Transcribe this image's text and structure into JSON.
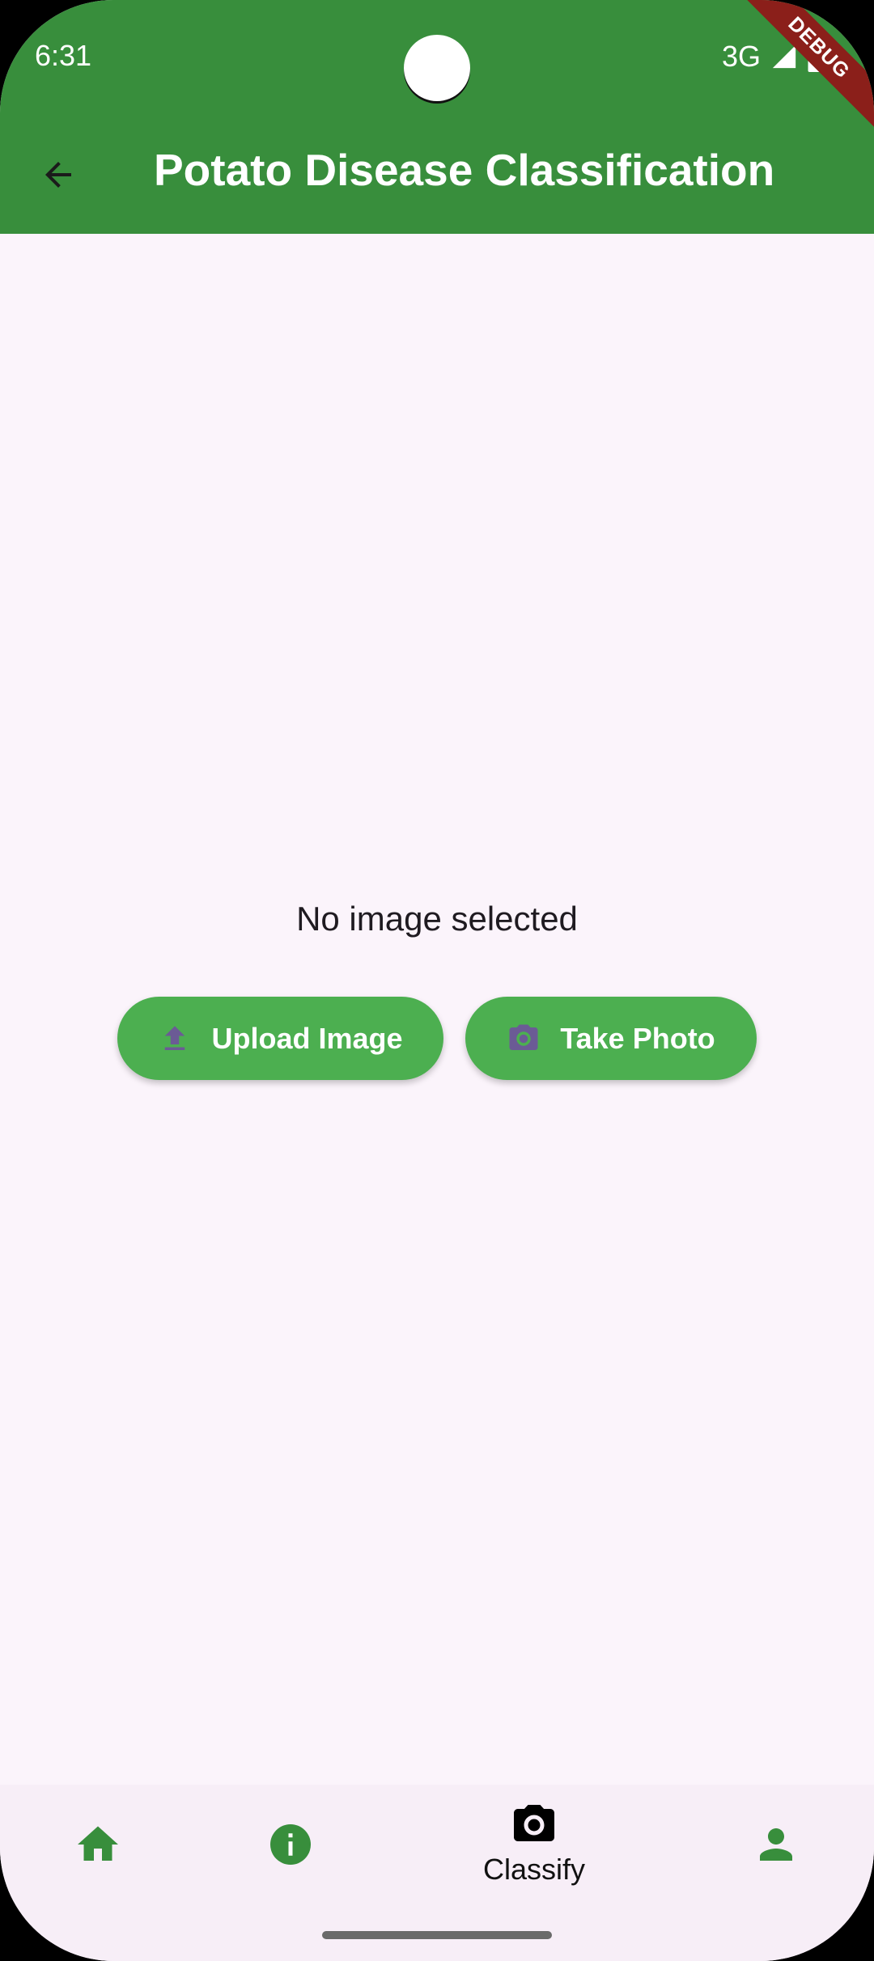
{
  "status_bar": {
    "time": "6:31",
    "network": "3G"
  },
  "debug_banner": "DEBUG",
  "app_bar": {
    "title": "Potato Disease Classification",
    "back_icon": "arrow-back-icon"
  },
  "main": {
    "empty_message": "No image selected",
    "upload_button": {
      "label": "Upload Image",
      "icon": "upload-icon"
    },
    "photo_button": {
      "label": "Take Photo",
      "icon": "camera-icon"
    }
  },
  "bottom_nav": {
    "items": [
      {
        "icon": "home-icon",
        "label": ""
      },
      {
        "icon": "info-icon",
        "label": ""
      },
      {
        "icon": "camera-icon",
        "label": "Classify",
        "selected": true
      },
      {
        "icon": "person-icon",
        "label": ""
      }
    ]
  },
  "colors": {
    "primary": "#388e3c",
    "button": "#4caf50",
    "button_icon": "#6b5b95",
    "background": "#fbf4fb",
    "debug": "#8b1f1a"
  }
}
